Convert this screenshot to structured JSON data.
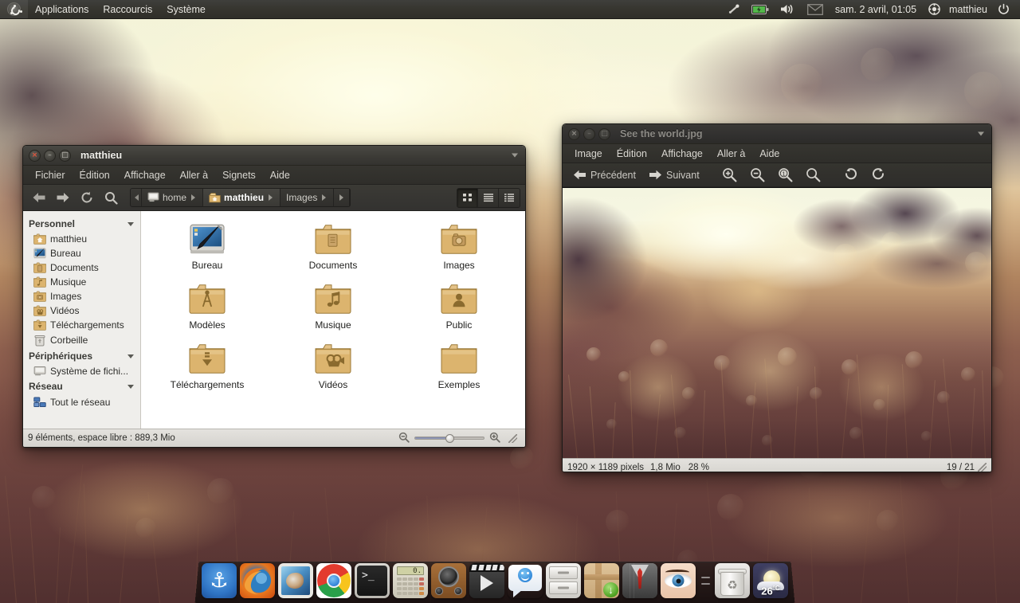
{
  "panel": {
    "logo_icon": "ubuntu-logo-icon",
    "menus": [
      "Applications",
      "Raccourcis",
      "Système"
    ],
    "tray": [
      {
        "name": "bluetooth-icon",
        "glyph": "bluetooth"
      },
      {
        "name": "battery-icon",
        "glyph": "battery"
      },
      {
        "name": "volume-icon",
        "glyph": "speaker"
      },
      {
        "name": "mail-indicator-icon",
        "glyph": "envelope"
      }
    ],
    "clock": "sam.  2 avril, 01:05",
    "user": "matthieu",
    "session_icon": "user-session-icon",
    "power_icon": "power-icon"
  },
  "file_manager": {
    "title": "matthieu",
    "window_buttons": {
      "close": "×",
      "minimize": "–",
      "maximize": "□"
    },
    "menus": [
      "Fichier",
      "Édition",
      "Affichage",
      "Aller à",
      "Signets",
      "Aide"
    ],
    "toolbar": {
      "back": "back-icon",
      "forward": "forward-icon",
      "reload": "reload-icon",
      "search": "search-icon"
    },
    "breadcrumb": [
      {
        "label": "home",
        "icon": "computer-icon",
        "active": false
      },
      {
        "label": "matthieu",
        "icon": "home-folder-icon",
        "active": true
      },
      {
        "label": "Images",
        "icon": null,
        "active": false
      }
    ],
    "view_buttons": [
      {
        "name": "icon-view-button",
        "active": true
      },
      {
        "name": "list-view-button",
        "active": false
      },
      {
        "name": "compact-view-button",
        "active": false
      }
    ],
    "sidebar": [
      {
        "type": "group",
        "label": "Personnel"
      },
      {
        "type": "item",
        "label": "matthieu",
        "icon": "home-folder-icon"
      },
      {
        "type": "item",
        "label": "Bureau",
        "icon": "desktop-icon"
      },
      {
        "type": "item",
        "label": "Documents",
        "icon": "documents-folder-icon"
      },
      {
        "type": "item",
        "label": "Musique",
        "icon": "music-folder-icon"
      },
      {
        "type": "item",
        "label": "Images",
        "icon": "pictures-folder-icon"
      },
      {
        "type": "item",
        "label": "Vidéos",
        "icon": "videos-folder-icon"
      },
      {
        "type": "item",
        "label": "Téléchargements",
        "icon": "downloads-folder-icon"
      },
      {
        "type": "item",
        "label": "Corbeille",
        "icon": "trash-icon"
      },
      {
        "type": "group",
        "label": "Périphériques"
      },
      {
        "type": "item",
        "label": "Système de fichi...",
        "icon": "filesystem-icon"
      },
      {
        "type": "group",
        "label": "Réseau"
      },
      {
        "type": "item",
        "label": "Tout le réseau",
        "icon": "network-icon"
      }
    ],
    "files": [
      {
        "label": "Bureau",
        "icon": "desktop-folder-icon"
      },
      {
        "label": "Documents",
        "icon": "documents-folder-icon"
      },
      {
        "label": "Images",
        "icon": "pictures-folder-icon"
      },
      {
        "label": "Modèles",
        "icon": "templates-folder-icon"
      },
      {
        "label": "Musique",
        "icon": "music-folder-icon"
      },
      {
        "label": "Public",
        "icon": "public-folder-icon"
      },
      {
        "label": "Téléchargements",
        "icon": "downloads-folder-icon"
      },
      {
        "label": "Vidéos",
        "icon": "videos-folder-icon"
      },
      {
        "label": "Exemples",
        "icon": "plain-folder-icon"
      }
    ],
    "status": "9 éléments, espace libre : 889,3 Mio",
    "zoom_out_icon": "zoom-out-icon",
    "zoom_in_icon": "zoom-in-icon"
  },
  "image_viewer": {
    "title": "See the world.jpg",
    "window_buttons": {
      "close": "×",
      "minimize": "–",
      "maximize": "□"
    },
    "menus": [
      "Image",
      "Édition",
      "Affichage",
      "Aller à",
      "Aide"
    ],
    "toolbar": [
      {
        "name": "previous-button",
        "label": "Précédent",
        "icon": "arrow-left-icon"
      },
      {
        "name": "next-button",
        "label": "Suivant",
        "icon": "arrow-right-icon"
      },
      {
        "name": "zoom-in-button",
        "label": "",
        "icon": "zoom-in-icon"
      },
      {
        "name": "zoom-out-button",
        "label": "",
        "icon": "zoom-out-icon"
      },
      {
        "name": "normal-size-button",
        "label": "",
        "icon": "zoom-original-icon"
      },
      {
        "name": "best-fit-button",
        "label": "",
        "icon": "zoom-fit-icon"
      },
      {
        "name": "rotate-left-button",
        "label": "",
        "icon": "rotate-left-icon"
      },
      {
        "name": "rotate-right-button",
        "label": "",
        "icon": "rotate-right-icon"
      }
    ],
    "status": {
      "dimensions": "1920 × 1189 pixels",
      "filesize": "1,8 Mio",
      "zoom": "28 %",
      "position": "19 / 21"
    }
  },
  "dock": {
    "items": [
      {
        "name": "docky-icon",
        "label": "Docky",
        "kind": "docky"
      },
      {
        "name": "firefox-icon",
        "label": "Firefox",
        "kind": "firefox"
      },
      {
        "name": "thunderbird-icon",
        "label": "Thunderbird",
        "kind": "stamp"
      },
      {
        "name": "chrome-icon",
        "label": "Google Chrome",
        "kind": "chrome"
      },
      {
        "name": "terminal-icon",
        "label": "Terminal",
        "kind": "terminal",
        "glyph": ">_"
      },
      {
        "name": "calculator-icon",
        "label": "Calculatrice",
        "kind": "calc",
        "screen": "0."
      },
      {
        "name": "sound-icon",
        "label": "Son",
        "kind": "speaker"
      },
      {
        "name": "video-player-icon",
        "label": "Lecteur vidéo",
        "kind": "video"
      },
      {
        "name": "chat-icon",
        "label": "Messagerie",
        "kind": "chat"
      },
      {
        "name": "file-cabinet-icon",
        "label": "Fichiers",
        "kind": "cabinet"
      },
      {
        "name": "update-manager-icon",
        "label": "Mises à jour",
        "kind": "package"
      },
      {
        "name": "suit-icon",
        "label": "Application",
        "kind": "suit"
      },
      {
        "name": "eye-of-gnome-icon",
        "label": "Visionneur d'images",
        "kind": "eye"
      },
      {
        "name": "dock-separator",
        "label": "",
        "kind": "separator"
      },
      {
        "name": "trash-icon",
        "label": "Corbeille",
        "kind": "trash"
      },
      {
        "name": "weather-icon",
        "label": "Météo",
        "kind": "weather",
        "temp": "26",
        "unit": "°C"
      }
    ]
  },
  "colors": {
    "panel_bg": "#36352f",
    "window_chrome": "#3c3b36",
    "sidebar_bg": "#efeeeb",
    "content_bg": "#ffffff",
    "statusbar_bg": "#dcdad5",
    "folder": "#dcb46e",
    "accent_close": "#e2543c"
  }
}
